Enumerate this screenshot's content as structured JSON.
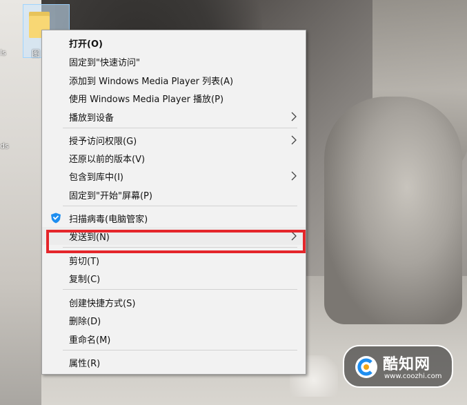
{
  "desktop": {
    "folder_label": "图",
    "edge_text_1": "ls",
    "edge_text_2": "ds"
  },
  "context_menu": {
    "items": [
      {
        "label": "打开(O)",
        "bold": true
      },
      {
        "label": "固定到\"快速访问\""
      },
      {
        "label": "添加到 Windows Media Player 列表(A)"
      },
      {
        "label": "使用 Windows Media Player 播放(P)"
      },
      {
        "label": "播放到设备",
        "submenu": true
      },
      {
        "label": "授予访问权限(G)",
        "submenu": true
      },
      {
        "label": "还原以前的版本(V)"
      },
      {
        "label": "包含到库中(I)",
        "submenu": true
      },
      {
        "label": "固定到\"开始\"屏幕(P)"
      },
      {
        "label": "扫描病毒(电脑管家)",
        "icon": "tencent-shield-icon"
      },
      {
        "label": "发送到(N)",
        "submenu": true,
        "highlighted": true
      },
      {
        "label": "剪切(T)"
      },
      {
        "label": "复制(C)"
      },
      {
        "label": "创建快捷方式(S)"
      },
      {
        "label": "删除(D)"
      },
      {
        "label": "重命名(M)"
      },
      {
        "label": "属性(R)"
      }
    ]
  },
  "watermark": {
    "title": "酷知网",
    "url": "www.coozhi.com"
  },
  "colors": {
    "menu_bg": "#f2f2f2",
    "highlight_border": "#e4262b",
    "folder_yellow": "#f8d774",
    "shield_blue": "#1e8ef0"
  }
}
